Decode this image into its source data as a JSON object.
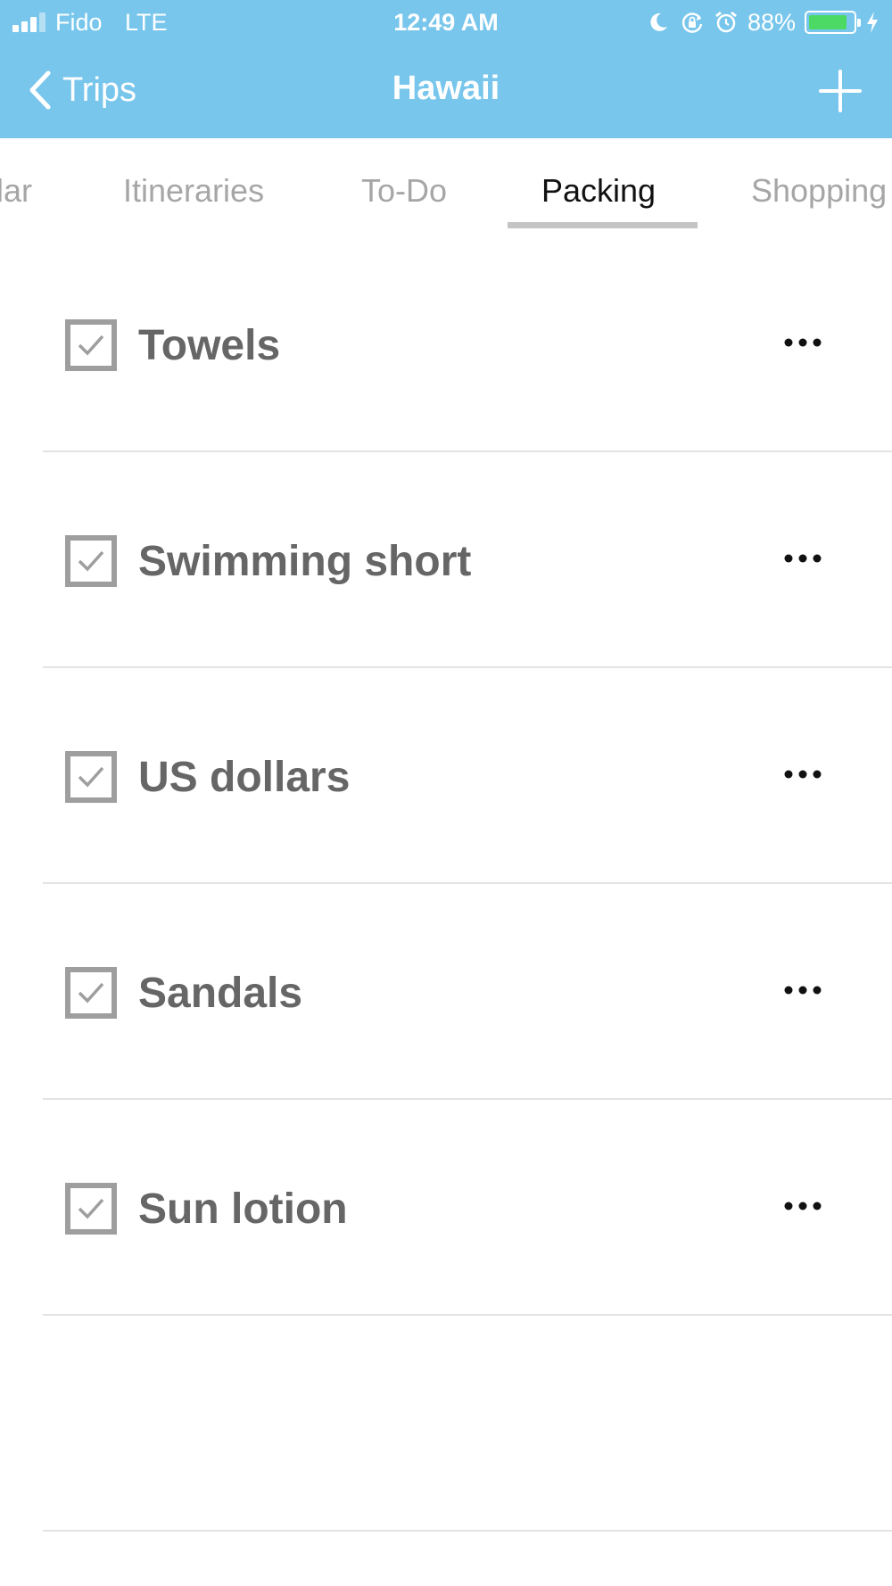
{
  "status_bar": {
    "carrier": "Fido",
    "network": "LTE",
    "time": "12:49 AM",
    "battery_percent": "88%",
    "battery_level": 0.88,
    "battery_color": "#4cd964",
    "icons": [
      "signal-icon",
      "moon-icon",
      "rotation-lock-icon",
      "alarm-icon",
      "battery-icon",
      "charging-icon"
    ]
  },
  "nav": {
    "back_label": "Trips",
    "title": "Hawaii",
    "add_icon": "plus-icon",
    "background_color": "#78c6ec"
  },
  "tabs": [
    {
      "label": "lar",
      "active": false
    },
    {
      "label": "Itineraries",
      "active": false
    },
    {
      "label": "To-Do",
      "active": false
    },
    {
      "label": "Packing",
      "active": true
    },
    {
      "label": "Shopping",
      "active": false
    }
  ],
  "packing_items": [
    {
      "label": "Towels",
      "checked": true
    },
    {
      "label": "Swimming short",
      "checked": true
    },
    {
      "label": "US dollars",
      "checked": true
    },
    {
      "label": "Sandals",
      "checked": true
    },
    {
      "label": "Sun lotion",
      "checked": true
    }
  ]
}
